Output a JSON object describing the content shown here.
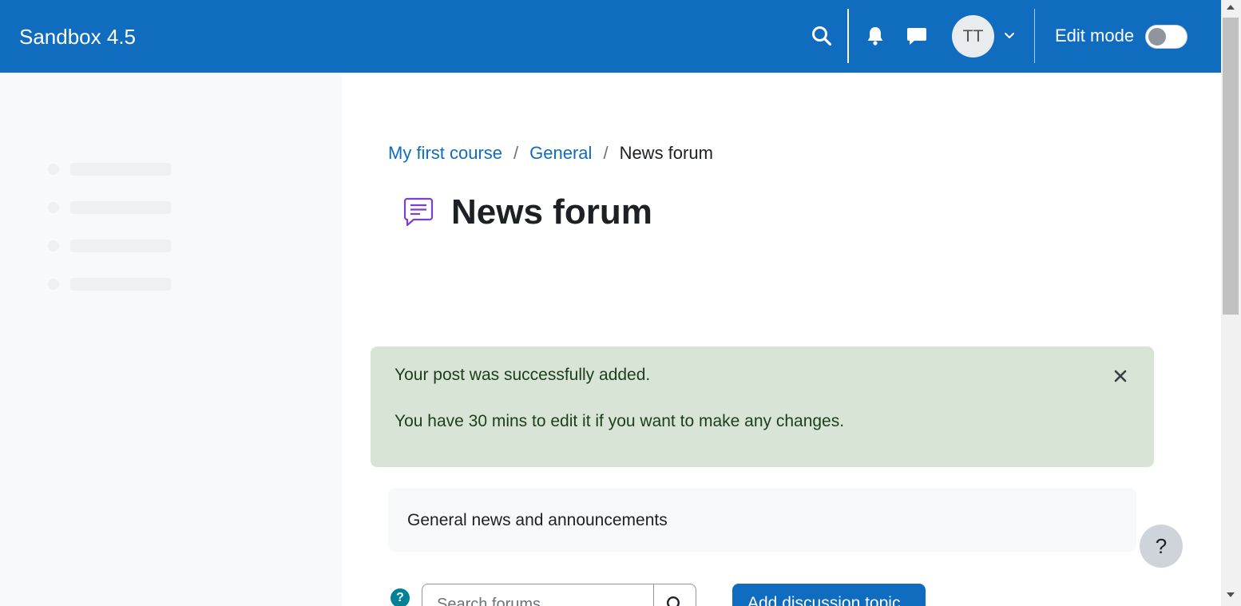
{
  "navbar": {
    "brand": "Sandbox 4.5",
    "user_initials": "TT",
    "edit_mode_label": "Edit mode",
    "edit_mode_on": false,
    "icons": [
      "search-icon",
      "bell-icon",
      "chat-icon",
      "chevron-down-icon"
    ]
  },
  "breadcrumb": {
    "items": [
      "My first course",
      "General"
    ],
    "current": "News forum"
  },
  "page": {
    "title": "News forum",
    "icon": "forum-icon",
    "icon_color": "#7b3fd1"
  },
  "alert": {
    "line1": "Your post was successfully added.",
    "line2": "You have 30 mins to edit it if you want to make any changes."
  },
  "intro": "General news and announcements",
  "search": {
    "placeholder": "Search forums",
    "help_glyph": "?"
  },
  "actions": {
    "add_topic": "Add discussion topic"
  },
  "help_fab": "?",
  "colors": {
    "primary": "#0f6cbf",
    "success_bg": "#d7e4d6",
    "success_text": "#1c3f1a",
    "info": "#008196"
  }
}
